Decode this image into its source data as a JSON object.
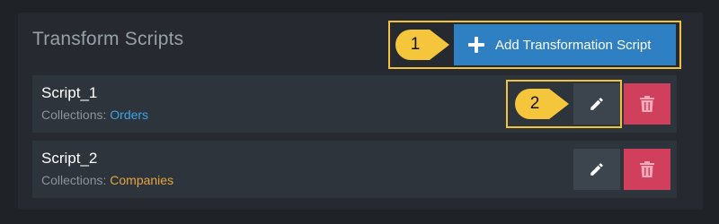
{
  "page": {
    "title": "Transform Scripts"
  },
  "toolbar": {
    "add_label": "Add Transformation Script"
  },
  "callouts": [
    {
      "label": "1"
    },
    {
      "label": "2"
    }
  ],
  "scripts": [
    {
      "name": "Script_1",
      "collections_label": "Collections:",
      "collection": "Orders",
      "collection_color": "#3fa3ea"
    },
    {
      "name": "Script_2",
      "collections_label": "Collections:",
      "collection": "Companies",
      "collection_color": "#e4a642"
    }
  ],
  "colors": {
    "accent_blue": "#2f7fc3",
    "delete_red": "#d0405d",
    "highlight": "#f0c23d"
  },
  "icons": {
    "add": "plus-icon",
    "edit": "pencil-icon",
    "delete": "trash-icon"
  }
}
